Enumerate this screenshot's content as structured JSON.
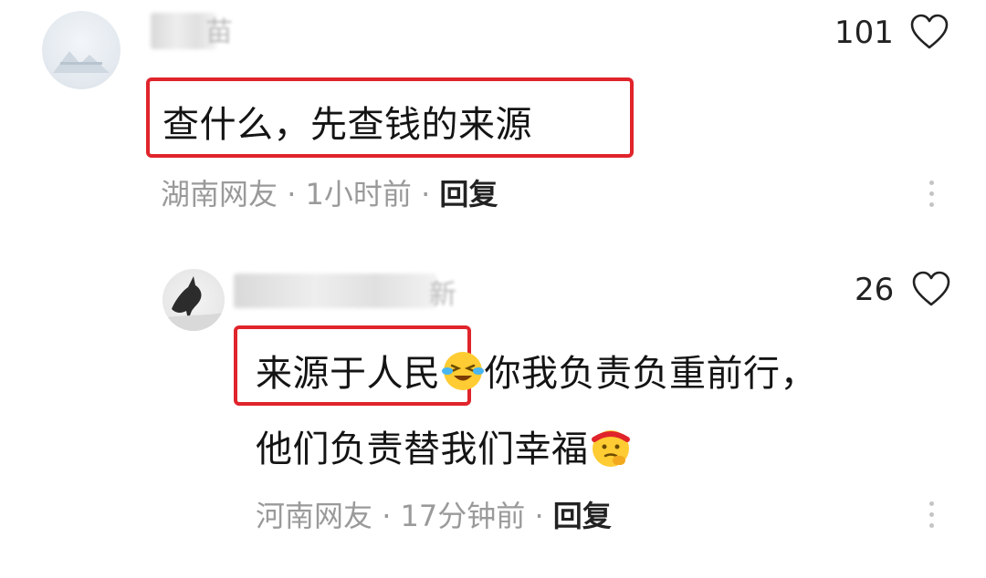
{
  "comments": [
    {
      "text": "查什么，先查钱的来源",
      "location": "湖南网友",
      "time": "1小时前",
      "reply_label": "回复",
      "likes": "101",
      "name_visible_char": "苗"
    },
    {
      "text_highlight": "来源于人民",
      "text_rest_line1": "你我负责负重前行，",
      "text_line2": "他们负责替我们幸福",
      "location": "河南网友",
      "time": "17分钟前",
      "reply_label": "回复",
      "likes": "26",
      "name_visible_char": "新"
    }
  ],
  "separator": "·",
  "colors": {
    "highlight_box": "#e0242b",
    "meta": "#9a9a9a"
  },
  "icons": [
    "heart-outline-icon",
    "more-vertical-icon",
    "laughing-tears-emoji",
    "thinking-emoji"
  ]
}
